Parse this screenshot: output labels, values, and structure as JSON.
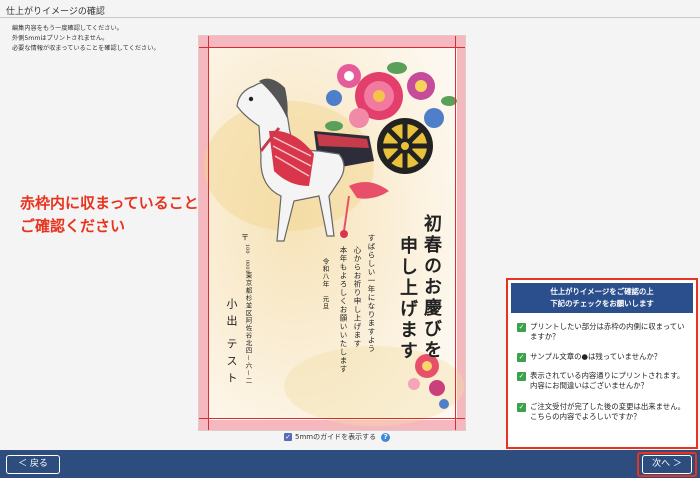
{
  "header": {
    "title": "仕上がりイメージの確認",
    "notes": [
      "編集内容をもう一度確認してください。",
      "外側5mmはプリントされません。",
      "必要な情報が収まっていることを確認してください。"
    ]
  },
  "callout": {
    "line1": "赤枠内に収まっていることを",
    "line2": "ご確認ください"
  },
  "card": {
    "greeting_col1": "初春のお慶びを",
    "greeting_col2": "申し上げます",
    "message": [
      "すばらしい一年になりますよう",
      "心からお祈り申し上げます",
      "本年もよろしくお願いいたします"
    ],
    "era": "令和八年　元旦",
    "zip_mark": "〒",
    "zip_upper": "100",
    "zip_lower": "0001",
    "address": "東京都杉並区阿佐谷北四－六－二",
    "name1": "小出",
    "name2": "テスト"
  },
  "guide_toggle": {
    "label": "5mmのガイドを表示する",
    "checked": true,
    "check_glyph": "✓",
    "help_glyph": "?"
  },
  "checklist": {
    "heading_line1": "仕上がりイメージをご確認の上",
    "heading_line2": "下記のチェックをお願いします",
    "check_glyph": "✓",
    "items": [
      "プリントしたい部分は赤枠の内側に収まっていますか？",
      "サンプル文章の●は残っていませんか？",
      "表示されている内容通りにプリントされます。内容にお間違いはございませんか？",
      "ご注文受付が完了した後の変更は出来ません。こちらの内容でよろしいですか？"
    ]
  },
  "footer": {
    "back_label": "＜ 戻る",
    "next_label": "次へ ＞"
  },
  "colors": {
    "accent_red": "#e8331e",
    "header_blue": "#2b4e8d",
    "footer_blue": "#2d4d7f",
    "check_green": "#3aa24c",
    "guide_red": "#d62d3b"
  }
}
